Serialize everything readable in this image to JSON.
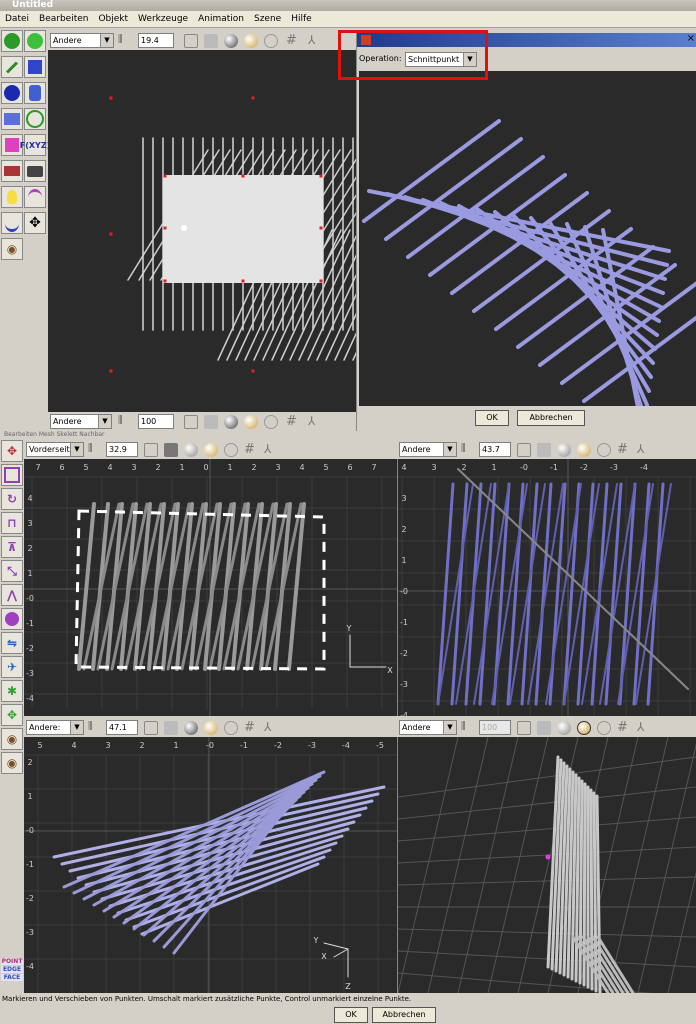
{
  "window": {
    "title": "Untitled"
  },
  "menu": [
    "Datei",
    "Bearbeiten",
    "Objekt",
    "Werkzeuge",
    "Animation",
    "Szene",
    "Hilfe"
  ],
  "top_view": {
    "mode": "Andere",
    "angle": "19.4",
    "bottom_mode": "Andere",
    "bottom_value": "100"
  },
  "dialog": {
    "operation_label": "Operation:",
    "operation_value": "Schnittpunkt",
    "close_glyph": "×",
    "ok_label": "OK",
    "cancel_label": "Abbrechen"
  },
  "obscured_menu": "Bearbeiten  Mesh  Skelett  Nachbar",
  "view_front": {
    "mode": "Vorderseite",
    "angle": "32.9",
    "x_ticks": [
      "7",
      "6",
      "5",
      "4",
      "3",
      "2",
      "1",
      "0",
      "1",
      "2",
      "3",
      "4",
      "5",
      "6",
      "7"
    ],
    "y_ticks": [
      "4",
      "3",
      "2",
      "1",
      "-0",
      "-1",
      "-2",
      "-3",
      "-4",
      "-5"
    ],
    "axis_y": "Y",
    "axis_x": "X"
  },
  "view_right": {
    "mode": "Andere",
    "angle": "43.7",
    "x_ticks": [
      "4",
      "3",
      "2",
      "1",
      "-0",
      "-1",
      "-2",
      "-3",
      "-4"
    ],
    "y_ticks": [
      "3",
      "2",
      "1",
      "-0",
      "-1",
      "-2",
      "-3",
      "-4"
    ]
  },
  "view_left_bottom": {
    "mode": "Andere:",
    "angle": "47.1",
    "x_ticks": [
      "5",
      "4",
      "3",
      "2",
      "1",
      "-0",
      "-1",
      "-2",
      "-3",
      "-4",
      "-5"
    ],
    "y_ticks": [
      "2",
      "1",
      "-0",
      "-1",
      "-2",
      "-3",
      "-4"
    ],
    "axis_y": "Y",
    "axis_x": "X",
    "axis_z": "Z"
  },
  "view_persp": {
    "mode": "Andere",
    "angle": "100"
  },
  "selection_modes": [
    "POINT",
    "EDGE",
    "FACE"
  ],
  "status_text": "Markieren und Verschieben von Punkten. Umschalt markiert zusätzliche Punkte, Control unmarkiert einzelne Punkte.",
  "bottom_ok": "OK",
  "bottom_cancel": "Abbrechen",
  "tools_top": [
    "F(XYZ)"
  ]
}
